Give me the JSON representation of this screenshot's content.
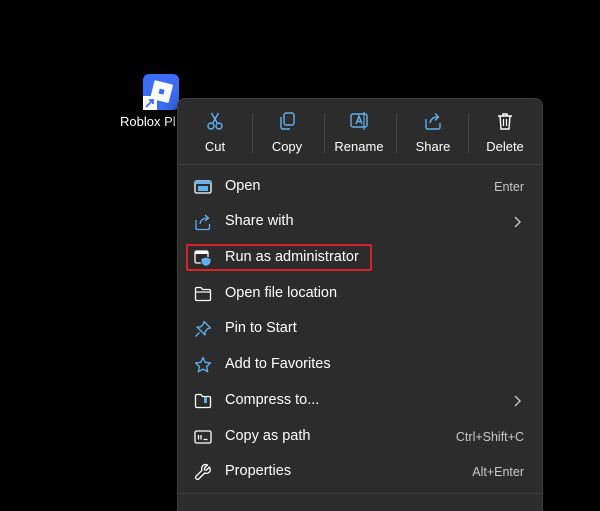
{
  "desktop": {
    "icon": {
      "name": "roblox-player-icon",
      "label": "Roblox Pl",
      "tile_color": "#3b6df6"
    }
  },
  "context_menu": {
    "quick_actions": [
      {
        "label": "Cut",
        "icon": "scissors-icon"
      },
      {
        "label": "Copy",
        "icon": "copy-icon"
      },
      {
        "label": "Rename",
        "icon": "rename-icon"
      },
      {
        "label": "Share",
        "icon": "share-icon"
      },
      {
        "label": "Delete",
        "icon": "trash-icon"
      }
    ],
    "items": [
      {
        "label": "Open",
        "shortcut": "Enter",
        "icon": "app-window-icon"
      },
      {
        "label": "Share with",
        "shortcut": "",
        "icon": "share-with-icon",
        "submenu": true
      },
      {
        "label": "Run as administrator",
        "shortcut": "",
        "icon": "shield-window-icon",
        "highlighted": true
      },
      {
        "label": "Open file location",
        "shortcut": "",
        "icon": "folder-icon"
      },
      {
        "label": "Pin to Start",
        "shortcut": "",
        "icon": "pin-icon"
      },
      {
        "label": "Add to Favorites",
        "shortcut": "",
        "icon": "star-icon"
      },
      {
        "label": "Compress to...",
        "shortcut": "",
        "icon": "zip-folder-icon",
        "submenu": true
      },
      {
        "label": "Copy as path",
        "shortcut": "Ctrl+Shift+C",
        "icon": "copy-path-icon"
      },
      {
        "label": "Properties",
        "shortcut": "Alt+Enter",
        "icon": "wrench-icon"
      }
    ],
    "accent_color": "#5fb2f2",
    "highlight_color": "#d8232a"
  }
}
